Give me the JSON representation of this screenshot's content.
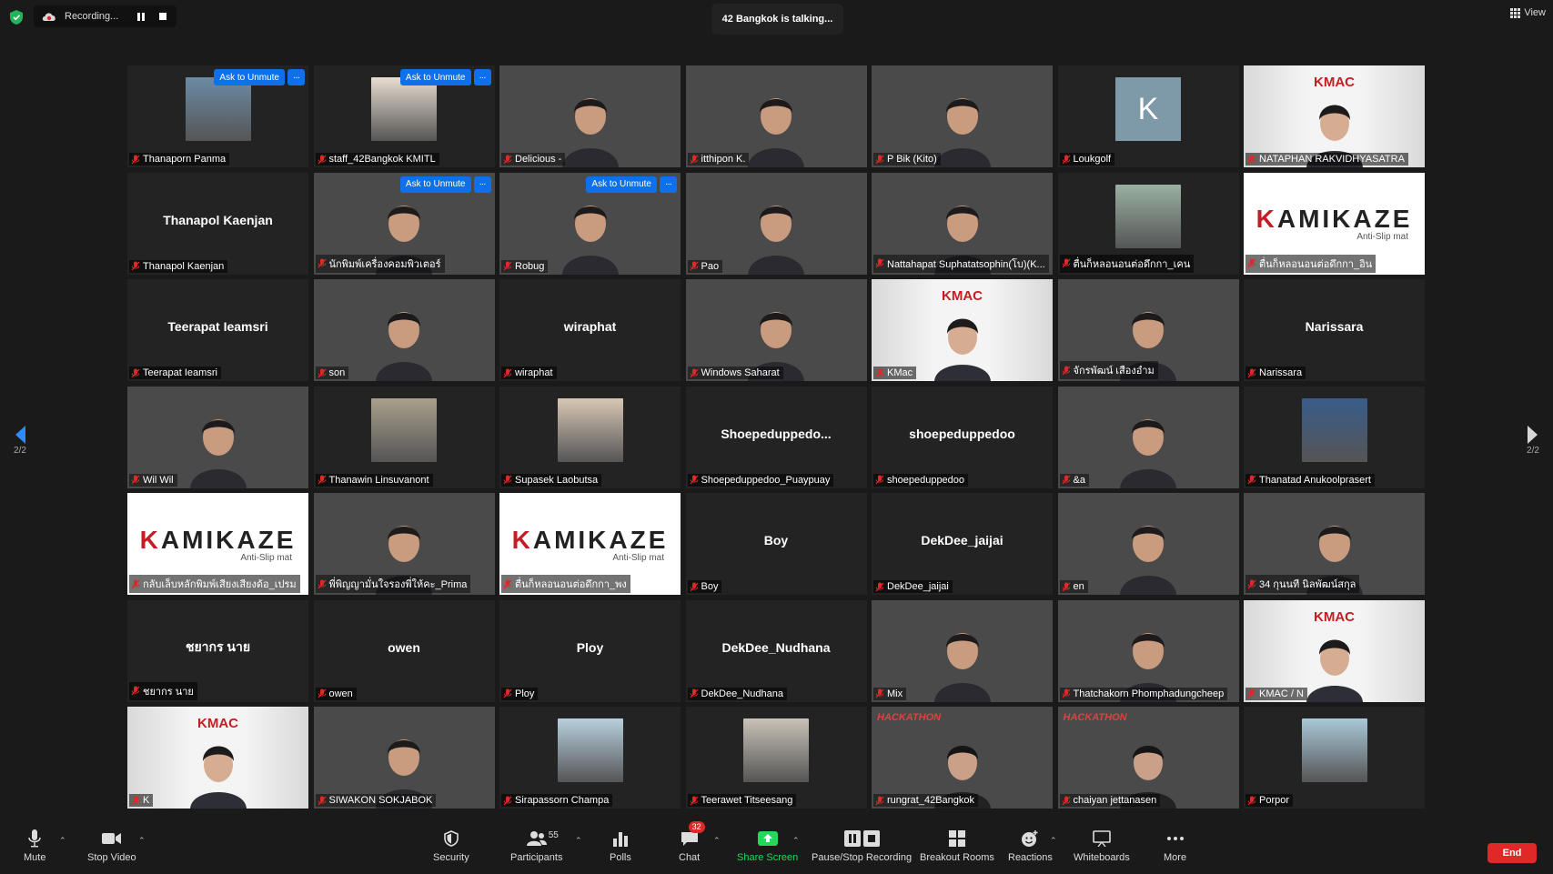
{
  "window": {
    "recording_label": "Recording...",
    "talking_label": "42 Bangkok is talking...",
    "view_label": "View"
  },
  "colors": {
    "accent_blue": "#0e71eb",
    "end_red": "#e02828",
    "share_green": "#23d959",
    "background": "#1a1a1a",
    "tile_bg": "#232323"
  },
  "grid": {
    "ask_to_unmute_label": "Ask to Unmute",
    "more_label": "···",
    "tiles": [
      {
        "name": "Thanaporn Panma",
        "kind": "thumb",
        "unmute": true
      },
      {
        "name": "staff_42Bangkok KMITL",
        "kind": "thumb",
        "unmute": true
      },
      {
        "name": "Delicious -",
        "kind": "video"
      },
      {
        "name": "itthipon K.",
        "kind": "video"
      },
      {
        "name": "P Bik (Kito)",
        "kind": "video"
      },
      {
        "name": "Loukgolf",
        "kind": "initial",
        "initial": "K"
      },
      {
        "name": "NATAPHAN RAKVIDHYASATRA",
        "kind": "kmac"
      },
      {
        "name": "Thanapol Kaenjan",
        "kind": "bigname",
        "display": "Thanapol Kaenjan"
      },
      {
        "name": "นักพิมพ์เครื่องคอมพิวเตอร์",
        "kind": "video",
        "unmute": true
      },
      {
        "name": "Robug",
        "kind": "video",
        "unmute": true
      },
      {
        "name": "Pao",
        "kind": "video"
      },
      {
        "name": "Nattahapat Suphatatsophin(โบ)(K...",
        "kind": "video"
      },
      {
        "name": "ตื่นก็หลอนอนต่อดึกกา_เคน",
        "kind": "thumb"
      },
      {
        "name": "ตื่นก็หลอนอนต่อดึกกา_อิน",
        "kind": "kamikaze"
      },
      {
        "name": "Teerapat Ieamsri",
        "kind": "bigname",
        "display": "Teerapat Ieamsri"
      },
      {
        "name": "son",
        "kind": "video"
      },
      {
        "name": "wiraphat",
        "kind": "bigname",
        "display": "wiraphat"
      },
      {
        "name": "Windows Saharat",
        "kind": "video"
      },
      {
        "name": "KMac",
        "kind": "kmac"
      },
      {
        "name": "จักรพัฒน์ เสืองอำม",
        "kind": "video"
      },
      {
        "name": "Narissara",
        "kind": "bigname",
        "display": "Narissara"
      },
      {
        "name": "Wil Wil",
        "kind": "video"
      },
      {
        "name": "Thanawin Linsuvanont",
        "kind": "thumb"
      },
      {
        "name": "Supasek Laobutsa",
        "kind": "thumb"
      },
      {
        "name": "Shoepeduppedoo_Puaypuay",
        "kind": "bigname",
        "display": "Shoepeduppedo..."
      },
      {
        "name": "shoepeduppedoo",
        "kind": "bigname",
        "display": "shoepeduppedoo"
      },
      {
        "name": "&a",
        "kind": "video"
      },
      {
        "name": "Thanatad Anukoolprasert",
        "kind": "thumb"
      },
      {
        "name": "กลับเล็บหลักพิมพ์เสียงเสียงด้อ_เปรม",
        "kind": "kamikaze"
      },
      {
        "name": "พี่พิญญามั่นใจรองพี่ให้คะ_Prima",
        "kind": "video"
      },
      {
        "name": "ตื่นก็หลอนอนต่อดึกกา_พง",
        "kind": "kamikaze"
      },
      {
        "name": "Boy",
        "kind": "bigname",
        "display": "Boy"
      },
      {
        "name": "DekDee_jaijai",
        "kind": "bigname",
        "display": "DekDee_jaijai"
      },
      {
        "name": "en",
        "kind": "video"
      },
      {
        "name": "34 กุนนที นิลพัฒน์สกุล",
        "kind": "video"
      },
      {
        "name": "ชยากร นาย",
        "kind": "bigname",
        "display": "ชยากร นาย"
      },
      {
        "name": "owen",
        "kind": "bigname",
        "display": "owen"
      },
      {
        "name": "Ploy",
        "kind": "bigname",
        "display": "Ploy"
      },
      {
        "name": "DekDee_Nudhana",
        "kind": "bigname",
        "display": "DekDee_Nudhana"
      },
      {
        "name": "Mix",
        "kind": "video"
      },
      {
        "name": "Thatchakorn Phomphadungcheep",
        "kind": "video"
      },
      {
        "name": "KMAC / N",
        "kind": "kmac"
      },
      {
        "name": "K",
        "kind": "kmac"
      },
      {
        "name": "SIWAKON SOKJABOK",
        "kind": "video"
      },
      {
        "name": "Sirapassorn Champa",
        "kind": "thumb"
      },
      {
        "name": "Teerawet Titseesang",
        "kind": "thumb"
      },
      {
        "name": "rungrat_42Bangkok",
        "kind": "hack"
      },
      {
        "name": "chaiyan jettanasen",
        "kind": "hack"
      },
      {
        "name": "Porpor",
        "kind": "thumb"
      }
    ]
  },
  "pager": {
    "left_label": "2/2",
    "right_label": "2/2"
  },
  "toolbar": {
    "mute": "Mute",
    "stop_video": "Stop Video",
    "security": "Security",
    "participants": "Participants",
    "participants_count": "55",
    "polls": "Polls",
    "chat": "Chat",
    "chat_badge": "32",
    "share_screen": "Share Screen",
    "pause_recording": "Pause/Stop Recording",
    "breakout_rooms": "Breakout Rooms",
    "reactions": "Reactions",
    "whiteboards": "Whiteboards",
    "more": "More",
    "end": "End"
  },
  "kamikaze": {
    "word_k": "K",
    "word_rest": "AMIKAZE",
    "sub": "Anti-Slip mat"
  },
  "kmac_logo": "KMAC",
  "hack_logo": "HACKATHON"
}
